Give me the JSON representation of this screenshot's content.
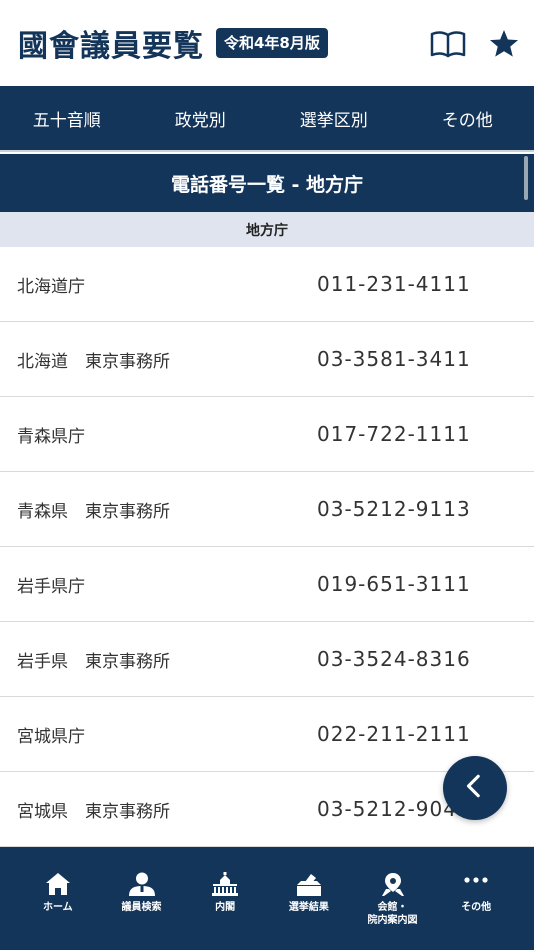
{
  "header": {
    "title": "國會議員要覧",
    "edition": "令和4年8月版",
    "book_icon": "book-icon",
    "star_icon": "star-icon"
  },
  "tabs": [
    {
      "label": "五十音順"
    },
    {
      "label": "政党別"
    },
    {
      "label": "選挙区別"
    },
    {
      "label": "その他"
    }
  ],
  "section_title": "電話番号一覧 - 地方庁",
  "subheader": "地方庁",
  "rows": [
    {
      "name": "北海道庁",
      "phone": "011-231-4111"
    },
    {
      "name": "北海道　東京事務所",
      "phone": "03-3581-3411"
    },
    {
      "name": "青森県庁",
      "phone": "017-722-1111"
    },
    {
      "name": "青森県　東京事務所",
      "phone": "03-5212-9113"
    },
    {
      "name": "岩手県庁",
      "phone": "019-651-3111"
    },
    {
      "name": "岩手県　東京事務所",
      "phone": "03-3524-8316"
    },
    {
      "name": "宮城県庁",
      "phone": "022-211-2111"
    },
    {
      "name": "宮城県　東京事務所",
      "phone": "03-5212-9045"
    }
  ],
  "fab_icon": "chevron-left-icon",
  "bottom_nav": [
    {
      "label": "ホーム",
      "icon": "home-icon"
    },
    {
      "label": "議員検索",
      "icon": "person-icon"
    },
    {
      "label": "内閣",
      "icon": "diet-building-icon"
    },
    {
      "label": "選挙結果",
      "icon": "ballot-box-icon"
    },
    {
      "label": "会館・\n院内案内図",
      "icon": "map-pin-icon"
    },
    {
      "label": "その他",
      "icon": "more-icon"
    }
  ],
  "colors": {
    "primary": "#14355a",
    "subheader_bg": "#dfe4ef"
  }
}
